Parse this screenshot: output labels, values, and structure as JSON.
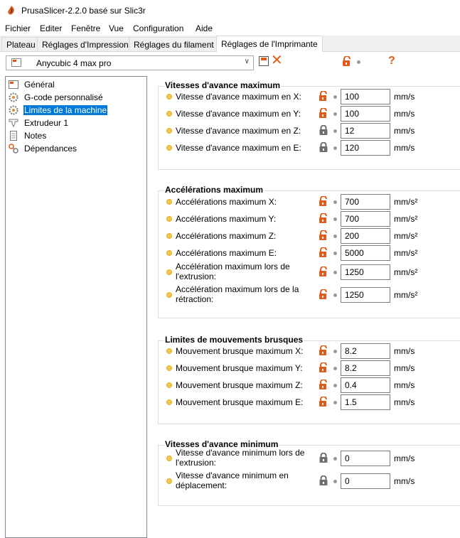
{
  "window": {
    "title": "PrusaSlicer-2.2.0 basé sur Slic3r"
  },
  "menu": [
    "Fichier",
    "Editer",
    "Fenêtre",
    "Vue",
    "Configuration",
    "Aide"
  ],
  "tabs": [
    "Plateau",
    "Réglages d'Impression",
    "Réglages du filament",
    "Réglages de l'Imprimante"
  ],
  "active_tab": "Réglages de l'Imprimante",
  "preset": {
    "name": "Anycubic 4 max pro"
  },
  "colors": {
    "accent": "#e05a1a",
    "selection": "#0078d7",
    "lock_gray": "#6e6e6e",
    "dot_yellow": "#f2c94c"
  },
  "tree": [
    {
      "label": "Général",
      "icon": "printer-icon"
    },
    {
      "label": "G-code personnalisé",
      "icon": "cog-icon"
    },
    {
      "label": "Limites de la machine",
      "icon": "cog-icon",
      "selected": true
    },
    {
      "label": "Extrudeur 1",
      "icon": "funnel-icon"
    },
    {
      "label": "Notes",
      "icon": "note-icon"
    },
    {
      "label": "Dépendances",
      "icon": "wrench-icon"
    }
  ],
  "groups": [
    {
      "title": "Vitesses d'avance maximum",
      "rows": [
        {
          "label": "Vitesse d'avance maximum en X:",
          "value": "100",
          "unit": "mm/s",
          "lock": "open"
        },
        {
          "label": "Vitesse d'avance maximum en Y:",
          "value": "100",
          "unit": "mm/s",
          "lock": "open"
        },
        {
          "label": "Vitesse d'avance maximum en Z:",
          "value": "12",
          "unit": "mm/s",
          "lock": "closed"
        },
        {
          "label": "Vitesse d'avance maximum en E:",
          "value": "120",
          "unit": "mm/s",
          "lock": "closed"
        }
      ]
    },
    {
      "title": "Accélérations maximum",
      "rows": [
        {
          "label": "Accélérations maximum X:",
          "value": "700",
          "unit": "mm/s²",
          "lock": "open"
        },
        {
          "label": "Accélérations maximum Y:",
          "value": "700",
          "unit": "mm/s²",
          "lock": "open"
        },
        {
          "label": "Accélérations maximum Z:",
          "value": "200",
          "unit": "mm/s²",
          "lock": "open"
        },
        {
          "label": "Accélérations maximum E:",
          "value": "5000",
          "unit": "mm/s²",
          "lock": "open"
        },
        {
          "label": "Accélération maximum lors de\nl'extrusion:",
          "value": "1250",
          "unit": "mm/s²",
          "lock": "open"
        },
        {
          "label": "Accélération maximum lors de la\nrétraction:",
          "value": "1250",
          "unit": "mm/s²",
          "lock": "open"
        }
      ]
    },
    {
      "title": "Limites de mouvements brusques",
      "rows": [
        {
          "label": "Mouvement brusque maximum X:",
          "value": "8.2",
          "unit": "mm/s",
          "lock": "open"
        },
        {
          "label": "Mouvement brusque maximum Y:",
          "value": "8.2",
          "unit": "mm/s",
          "lock": "open"
        },
        {
          "label": "Mouvement brusque maximum Z:",
          "value": "0.4",
          "unit": "mm/s",
          "lock": "open"
        },
        {
          "label": "Mouvement brusque maximum E:",
          "value": "1.5",
          "unit": "mm/s",
          "lock": "open"
        }
      ]
    },
    {
      "title": "Vitesses d'avance minimum",
      "rows": [
        {
          "label": "Vitesse d'avance minimum lors de\nl'extrusion:",
          "value": "0",
          "unit": "mm/s",
          "lock": "closed"
        },
        {
          "label": "Vitesse d'avance minimum en\ndéplacement:",
          "value": "0",
          "unit": "mm/s",
          "lock": "closed"
        }
      ]
    }
  ]
}
